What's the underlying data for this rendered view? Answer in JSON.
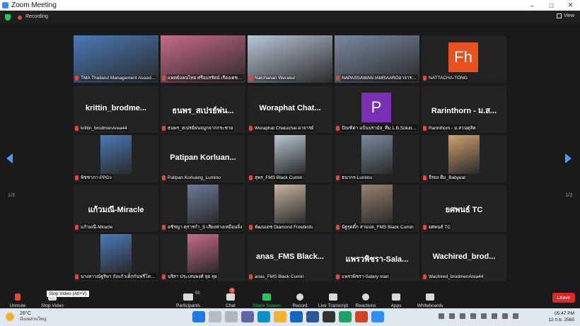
{
  "window": {
    "title": "Zoom Meeting",
    "controls": [
      "–",
      "□",
      "✕"
    ]
  },
  "topbar": {
    "recording_label": "Recording",
    "view_label": "View"
  },
  "pagination": {
    "left": "1/3",
    "right": "1/3"
  },
  "tiles": [
    {
      "name": "TMA Thailand Management Associ...",
      "type": "video",
      "speaking": true
    },
    {
      "name": "แพทย์แผนไทย ศรีอมรรัตน์ เรืองเดช ผล...",
      "type": "video"
    },
    {
      "name": "Natchanan Werakul",
      "type": "video"
    },
    {
      "name": "NAPASSAWAN IAMSAARDอาจารย์...",
      "type": "video"
    },
    {
      "name": "NATTACHA-TONG",
      "type": "avatar",
      "letter": "Fh",
      "avatar_color": "#e8521f"
    },
    {
      "name": "krittin_brodmenArea44",
      "type": "text",
      "big": "krittin_brodme..."
    },
    {
      "name": "ธนพร_สเปรย์พ่นจมูกจากกระชาย",
      "type": "text",
      "big": "ธนพร_สเปรย์พ่น..."
    },
    {
      "name": "Woraphat Chatuchai-อาจารย์",
      "type": "text",
      "big": "Woraphat Chat..."
    },
    {
      "name": "ปัณฑิตา แป้นปรามัย_ทีม L.B.Solution ...",
      "type": "avatar",
      "letter": "P",
      "avatar_color": "#7b2fb5"
    },
    {
      "name": "Rarinthorn - ม.สวนดุสิต",
      "type": "text",
      "big": "Rarinthorn - ม.ส..."
    },
    {
      "name": "พิชชาภา-PPGs",
      "type": "video"
    },
    {
      "name": "Patipan Korluang_Lumino",
      "type": "text",
      "big": "Patipan Korluan..."
    },
    {
      "name": "สุพร_FMS Black Cumin",
      "type": "video"
    },
    {
      "name": "ธนากร-Lumino",
      "type": "video"
    },
    {
      "name": "จีรยง ดีม_Babyeat",
      "type": "video"
    },
    {
      "name": "แก้วมณี-Miracle",
      "type": "text",
      "big": "แก้วมณี-Miracle"
    },
    {
      "name": "อชิรญา ตุรารกำ_S เสียงห่างเหมือนจิ่ง",
      "type": "video"
    },
    {
      "name": "พัฒนเดช Diamond Freebirds",
      "type": "video"
    },
    {
      "name": "นัฐรุตติ์ก สามแด_FMS Black Cumin",
      "type": "video"
    },
    {
      "name": "ยศพนธ์ TC",
      "type": "text",
      "big": "ยศพนธ์ TC"
    },
    {
      "name": "นางสาวณัฐริษา กังแก้วเด็กกันฟรีโคเนอ...",
      "type": "video"
    },
    {
      "name": "นริสา ประเสนพงศ์ ลุย ลุย",
      "type": "video"
    },
    {
      "name": "anas_FMS Black Cumin",
      "type": "text",
      "big": "anas_FMS Black..."
    },
    {
      "name": "แพรวพิชรา-Salary man",
      "type": "text",
      "big": "แพรวพิชรา-Sala..."
    },
    {
      "name": "Wachired_brodmenArea44",
      "type": "text",
      "big": "Wachired_brod..."
    }
  ],
  "toolbar": {
    "unmute": "Unmute",
    "stop_video": "Stop Video",
    "tooltip": "Stop Video (Alt+V)",
    "participants": "Participants",
    "participants_count": "55",
    "chat": "Chat",
    "chat_badge": "3",
    "share_screen": "Share Screen",
    "record": "Record",
    "live_transcript": "Live Transcript",
    "reactions": "Reactions",
    "apps": "Apps",
    "whiteboards": "Whiteboards",
    "leave": "Leave"
  },
  "taskbar": {
    "temp": "26°C",
    "weather_desc": "มีเมฆส่วนใหญ่",
    "time": "05:47 PM",
    "date": "12 ก.ย. 2565"
  }
}
